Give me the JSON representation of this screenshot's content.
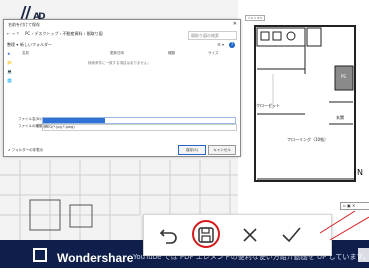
{
  "brand": {
    "logo": "//",
    "sub": "AD"
  },
  "dialog": {
    "title": "名前を付けて保存",
    "address_path": "PC › デスクトップ › 不動産資料 › 間取り図",
    "search_placeholder": "間取り図の検索",
    "toolbar": {
      "organize": "整理 ▾",
      "new_folder": "新しいフォルダー",
      "view": "☰ ▾",
      "help": "?"
    },
    "nav_items": [
      "★",
      "📁",
      "💻",
      "🌐"
    ],
    "columns": {
      "name": "名前",
      "date": "更新日時",
      "type": "種類",
      "size": "サイズ"
    },
    "empty_message": "検索条件に一致する項目はありません。",
    "file_name_label": "ファイル名(N):",
    "file_type_label": "ファイルの種類(T):",
    "file_type_value": "JPEG(*.jpg,*.jpeg)",
    "hide_folders": "∧ フォルダーの非表示",
    "save_button": "保存(S)",
    "cancel_button": "キャンセル"
  },
  "floor_plan": {
    "tag": "7.0 × 8.5",
    "closet": "クローゼット",
    "ps": "PS",
    "entrance": "玄関",
    "flooring": "フローリング（10帖）",
    "compass": "N"
  },
  "edit_toolbar": {
    "undo_icon": "undo-arrow",
    "save_icon": "floppy-disk",
    "close_icon": "x-mark",
    "confirm_icon": "check-mark",
    "highlight_color": "#d51a1a"
  },
  "mini_controls": "▫ ▣ ✕",
  "banner": {
    "brand": "Wondershare",
    "text": "YouTube では PDF エレメントの便利な使い方紹介動画を UP しています。",
    "bg_color": "#0f1e4a"
  }
}
